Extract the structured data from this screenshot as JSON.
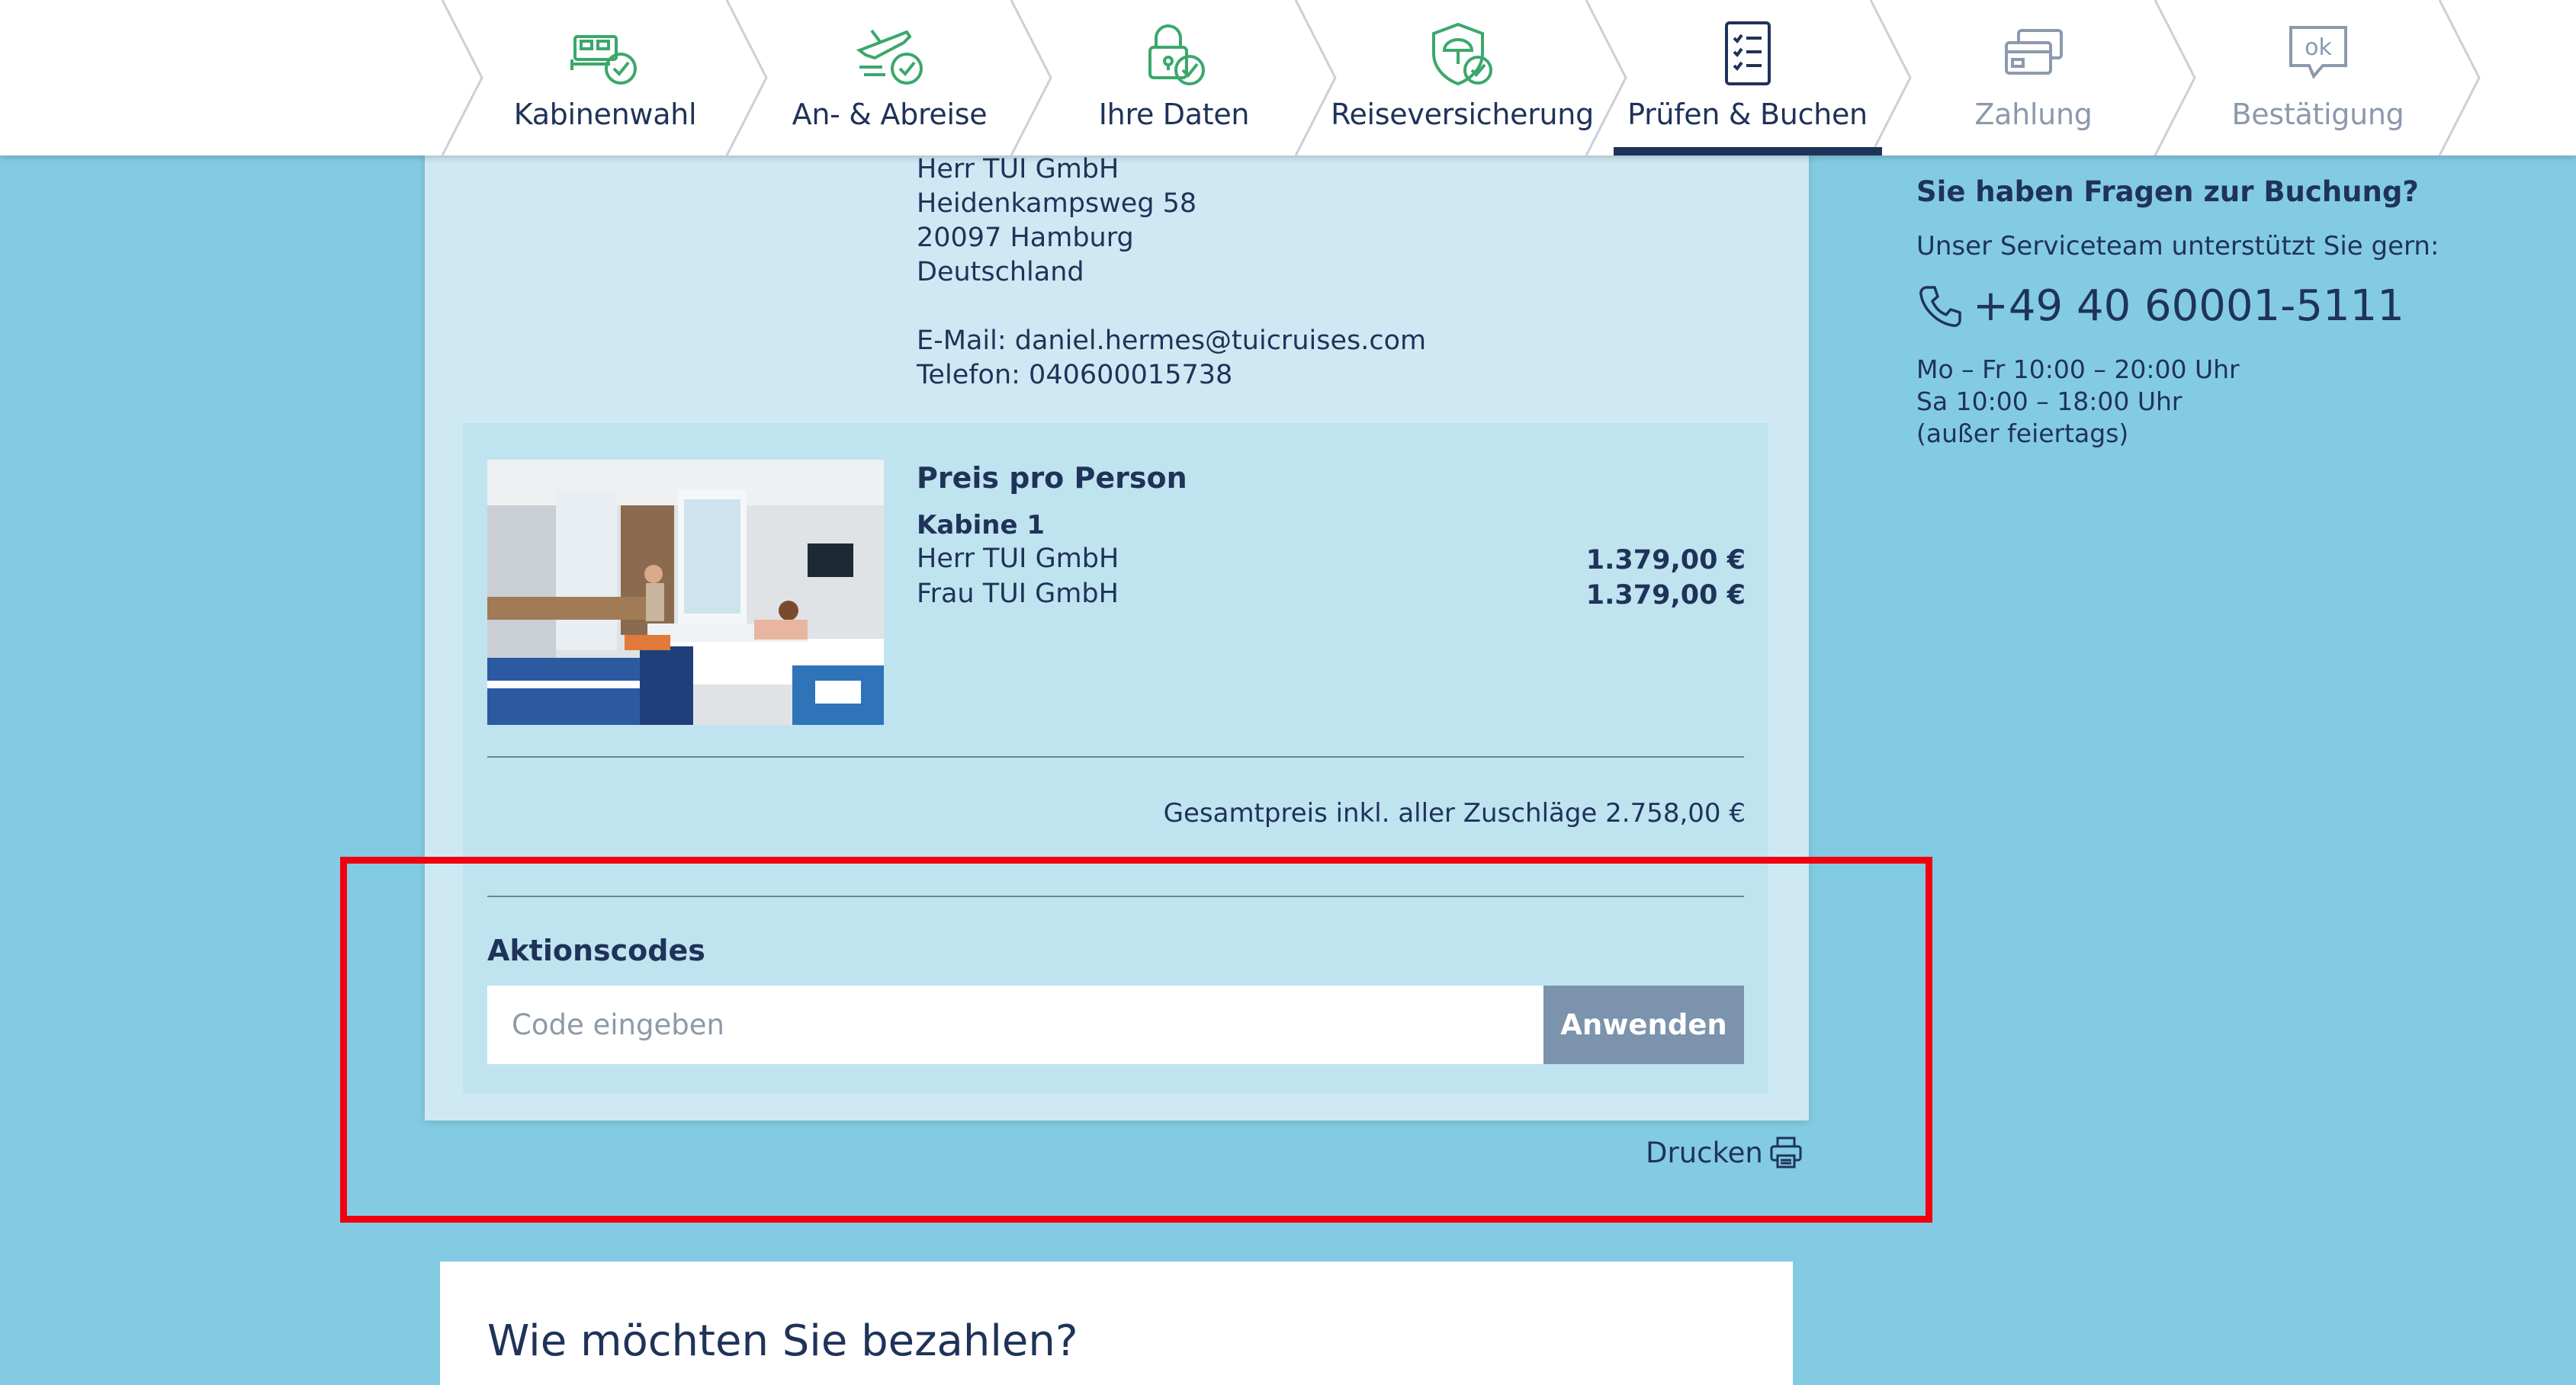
{
  "steps": [
    {
      "label": "Kabinenwahl",
      "state": "done",
      "icon": "cabin-bed-check-icon"
    },
    {
      "label": "An- & Abreise",
      "state": "done",
      "icon": "plane-check-icon"
    },
    {
      "label": "Ihre Daten",
      "state": "done",
      "icon": "lock-check-icon"
    },
    {
      "label": "Reiseversicherung",
      "state": "done",
      "icon": "shield-umbrella-check-icon"
    },
    {
      "label": "Prüfen & Buchen",
      "state": "active",
      "icon": "checklist-icon"
    },
    {
      "label": "Zahlung",
      "state": "disabled",
      "icon": "credit-card-icon"
    },
    {
      "label": "Bestätigung",
      "state": "disabled",
      "icon": "ok-bubble-icon"
    }
  ],
  "address": {
    "name": "Herr TUI GmbH",
    "street": "Heidenkampsweg 58",
    "city": "20097 Hamburg",
    "country": "Deutschland",
    "email": "E-Mail: daniel.hermes@tuicruises.com",
    "phone": "Telefon: 040600015738"
  },
  "price": {
    "title": "Preis pro Person",
    "cabin": "Kabine 1",
    "persons": [
      {
        "name": "Herr TUI GmbH",
        "amount": "1.379,00 €"
      },
      {
        "name": "Frau TUI GmbH",
        "amount": "1.379,00 €"
      }
    ],
    "total": "Gesamtpreis inkl. aller Zuschläge 2.758,00 €"
  },
  "promo": {
    "title": "Aktionscodes",
    "placeholder": "Code eingeben",
    "button": "Anwenden"
  },
  "print": "Drucken",
  "payment": {
    "title": "Wie möchten Sie bezahlen?"
  },
  "service": {
    "question": "Sie haben Fragen zur Buchung?",
    "subtitle": "Unser Serviceteam unterstützt Sie gern:",
    "phone": "+49 40 60001-5111",
    "hours": [
      "Mo – Fr 10:00 – 20:00 Uhr",
      "Sa 10:00 – 18:00 Uhr",
      "(außer feiertags)"
    ]
  },
  "colors": {
    "page_bg": "#83cbe3",
    "card_bg": "#cfe9f4",
    "price_bg": "#c0e3f0",
    "text": "#1f3359",
    "step_done": "#3aa86b",
    "step_disabled": "#8c99ad",
    "button_bg": "#7b93ad",
    "highlight": "#f2000f"
  }
}
